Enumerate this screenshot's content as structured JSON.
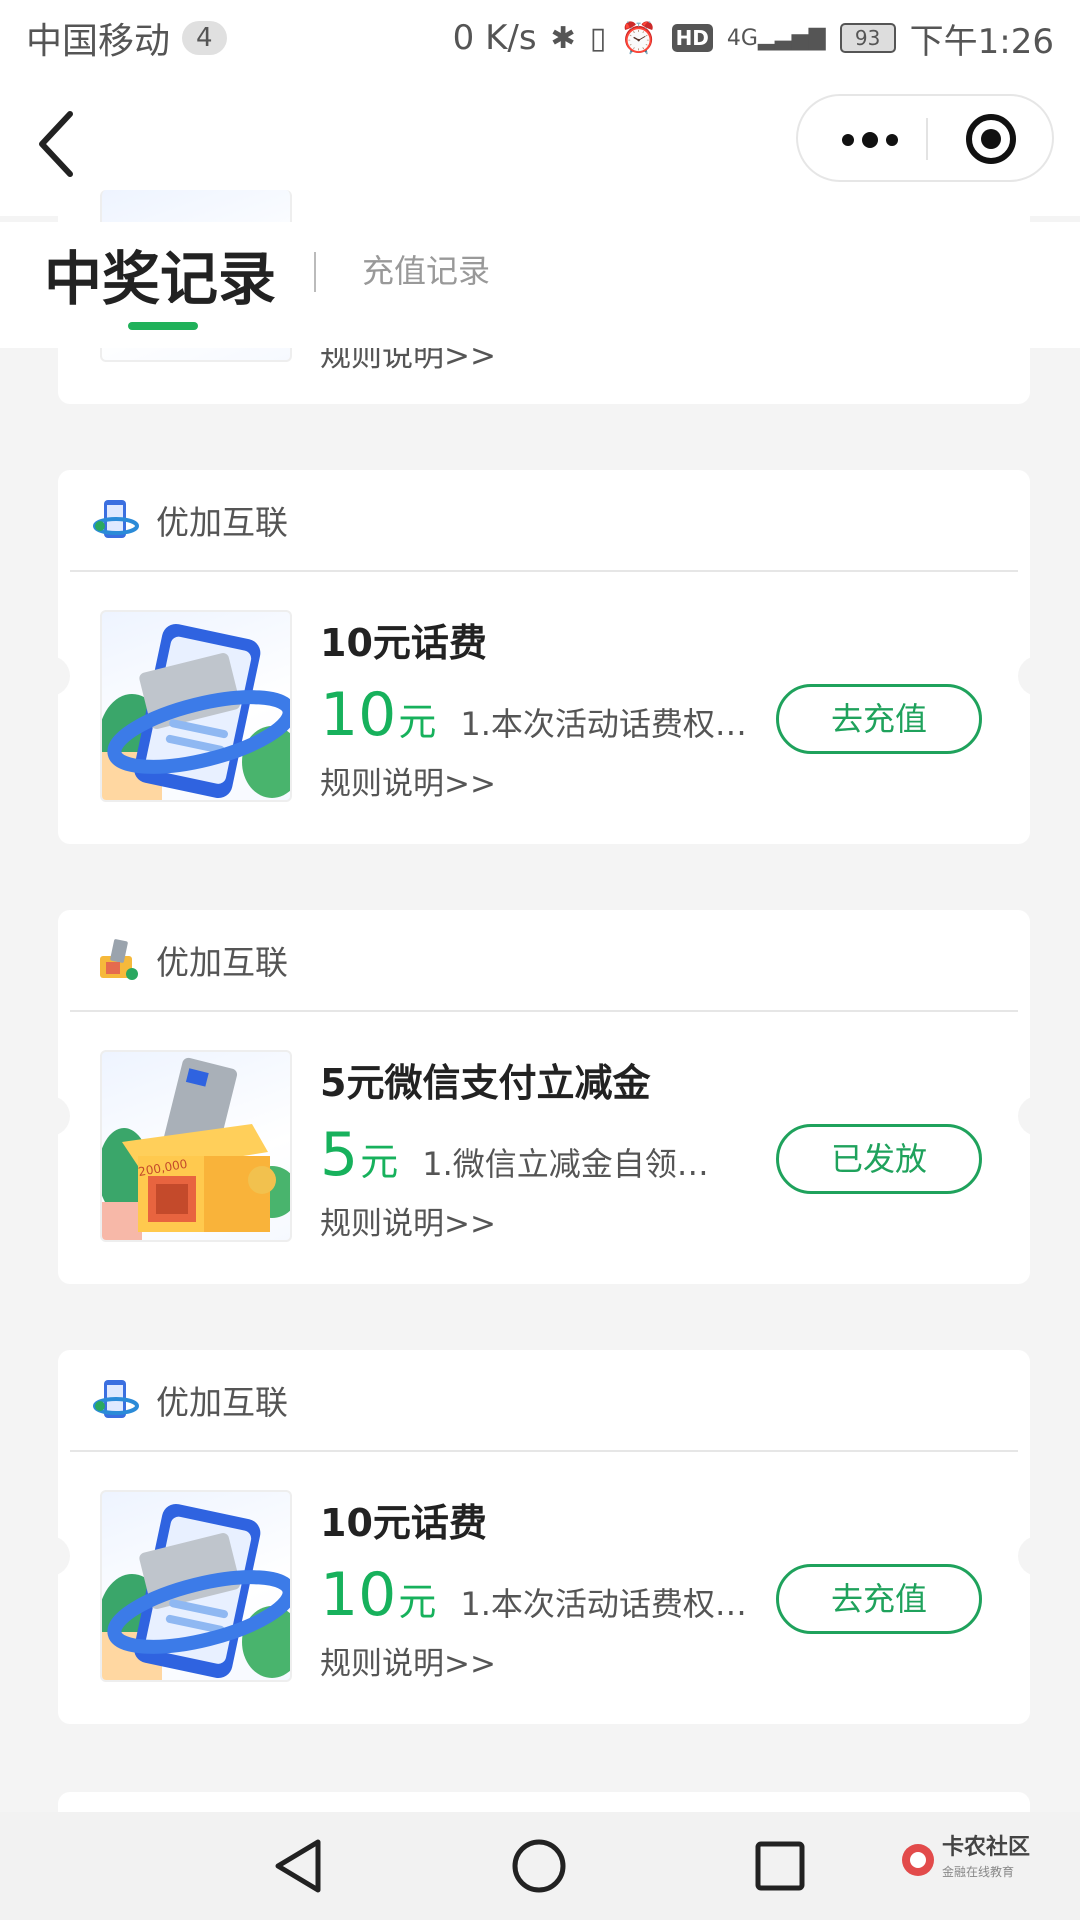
{
  "status_bar": {
    "carrier": "中国移动",
    "notif_count": "4",
    "net_speed": "0 K/s",
    "hd": "HD",
    "network": "4G",
    "battery": "93",
    "time": "下午1:26"
  },
  "tabs": {
    "active": "中奖记录",
    "inactive": "充值记录"
  },
  "partial_card": {
    "rules": "规则说明>>"
  },
  "records": [
    {
      "merchant": "优加互联",
      "title": "10元话费",
      "amount": "10",
      "unit": "元",
      "desc": "1.本次活动话费权…",
      "rules": "规则说明>>",
      "button": "去充值",
      "image": "phone-card-icon"
    },
    {
      "merchant": "优加互联",
      "title": "5元微信支付立减金",
      "amount": "5",
      "unit": "元",
      "desc": "1.微信立减金自领…",
      "rules": "规则说明>>",
      "button": "已发放",
      "image": "gift-box-icon"
    },
    {
      "merchant": "优加互联",
      "title": "10元话费",
      "amount": "10",
      "unit": "元",
      "desc": "1.本次活动话费权…",
      "rules": "规则说明>>",
      "button": "去充值",
      "image": "phone-card-icon"
    }
  ],
  "watermark": {
    "name": "卡农社区",
    "slogan": "金融在线教育"
  },
  "colors": {
    "accent": "#17b15c",
    "button_border": "#1fa25c",
    "background": "#f4f4f4"
  }
}
